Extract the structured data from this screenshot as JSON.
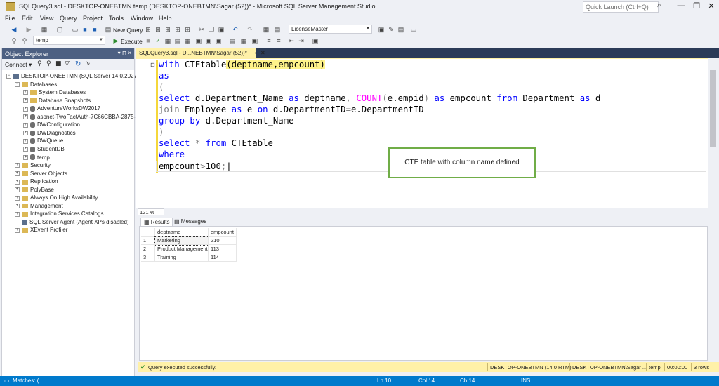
{
  "window": {
    "title": "SQLQuery3.sql - DESKTOP-ONEBTMN.temp (DESKTOP-ONEBTMN\\Sagar (52))* - Microsoft SQL Server Management Studio",
    "quick_launch": "Quick Launch (Ctrl+Q)"
  },
  "menu": [
    "File",
    "Edit",
    "View",
    "Query",
    "Project",
    "Tools",
    "Window",
    "Help"
  ],
  "toolbar": {
    "new_query": "New Query",
    "db_selector": "LicenseMaster",
    "current_db": "temp",
    "execute": "Execute"
  },
  "object_explorer": {
    "title": "Object Explorer",
    "pin": "▾ ⊓ ×",
    "connect": "Connect ▾",
    "nodes": [
      {
        "label": "DESKTOP-ONEBTMN (SQL Server 14.0.2027.2 -",
        "indent": 0,
        "kind": "server",
        "expander": "−"
      },
      {
        "label": "Databases",
        "indent": 1,
        "kind": "folder",
        "expander": "−"
      },
      {
        "label": "System Databases",
        "indent": 2,
        "kind": "folder",
        "expander": "+"
      },
      {
        "label": "Database Snapshots",
        "indent": 2,
        "kind": "folder",
        "expander": "+"
      },
      {
        "label": "AdventureWorksDW2017",
        "indent": 2,
        "kind": "db",
        "expander": "+"
      },
      {
        "label": "aspnet-TwoFactAuth-7C66CBBA-2875-",
        "indent": 2,
        "kind": "db",
        "expander": "+"
      },
      {
        "label": "DWConfiguration",
        "indent": 2,
        "kind": "db",
        "expander": "+"
      },
      {
        "label": "DWDiagnostics",
        "indent": 2,
        "kind": "db",
        "expander": "+"
      },
      {
        "label": "DWQueue",
        "indent": 2,
        "kind": "db",
        "expander": "+"
      },
      {
        "label": "StudentDB",
        "indent": 2,
        "kind": "db",
        "expander": "+"
      },
      {
        "label": "temp",
        "indent": 2,
        "kind": "db",
        "expander": "+"
      },
      {
        "label": "Security",
        "indent": 1,
        "kind": "folder",
        "expander": "+"
      },
      {
        "label": "Server Objects",
        "indent": 1,
        "kind": "folder",
        "expander": "+"
      },
      {
        "label": "Replication",
        "indent": 1,
        "kind": "folder",
        "expander": "+"
      },
      {
        "label": "PolyBase",
        "indent": 1,
        "kind": "folder",
        "expander": "+"
      },
      {
        "label": "Always On High Availability",
        "indent": 1,
        "kind": "folder",
        "expander": "+"
      },
      {
        "label": "Management",
        "indent": 1,
        "kind": "folder",
        "expander": "+"
      },
      {
        "label": "Integration Services Catalogs",
        "indent": 1,
        "kind": "folder",
        "expander": "+"
      },
      {
        "label": "SQL Server Agent (Agent XPs disabled)",
        "indent": 1,
        "kind": "agent",
        "expander": ""
      },
      {
        "label": "XEvent Profiler",
        "indent": 1,
        "kind": "folder",
        "expander": "+"
      }
    ]
  },
  "editor": {
    "tab_label": "SQLQuery3.sql - D...NEBTMN\\Sagar (52))*",
    "zoom": "121 %",
    "callout": "CTE table with column name defined"
  },
  "results": {
    "tab_results": "Results",
    "tab_messages": "Messages",
    "columns": [
      "deptname",
      "empcount"
    ],
    "rows": [
      {
        "n": "1",
        "deptname": "Marketing",
        "empcount": "210"
      },
      {
        "n": "2",
        "deptname": "Product Management",
        "empcount": "113"
      },
      {
        "n": "3",
        "deptname": "Training",
        "empcount": "114"
      }
    ]
  },
  "status": {
    "message": "Query executed successfully.",
    "server": "DESKTOP-ONEBTMN (14.0 RTM)",
    "user": "DESKTOP-ONEBTMN\\Sagar ...",
    "database": "temp",
    "elapsed": "00:00:00",
    "rows": "3 rows"
  },
  "bottom": {
    "matches": "Matches: (",
    "ln": "Ln 10",
    "col": "Col 14",
    "ch": "Ch 14",
    "mode": "INS"
  },
  "colors": {
    "accent": "#007acc",
    "tab": "#fff1a8",
    "keyword": "#0000ff",
    "function": "#ff00ff"
  }
}
